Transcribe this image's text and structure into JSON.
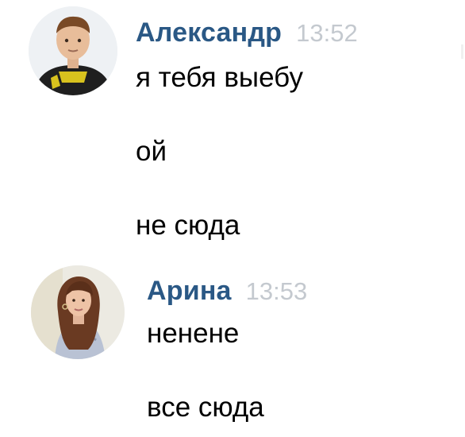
{
  "colors": {
    "author": "#2a5885",
    "time": "#c4c9cf",
    "text": "#000000",
    "background": "#ffffff"
  },
  "messages": [
    {
      "author": "Александр",
      "time": "13:52",
      "avatar_icon": "user-avatar-icon",
      "lines": [
        "я тебя выебу",
        "ой",
        "не сюда"
      ]
    },
    {
      "author": "Арина",
      "time": "13:53",
      "avatar_icon": "user-avatar-icon",
      "lines": [
        "ненене",
        "все сюда"
      ]
    }
  ]
}
